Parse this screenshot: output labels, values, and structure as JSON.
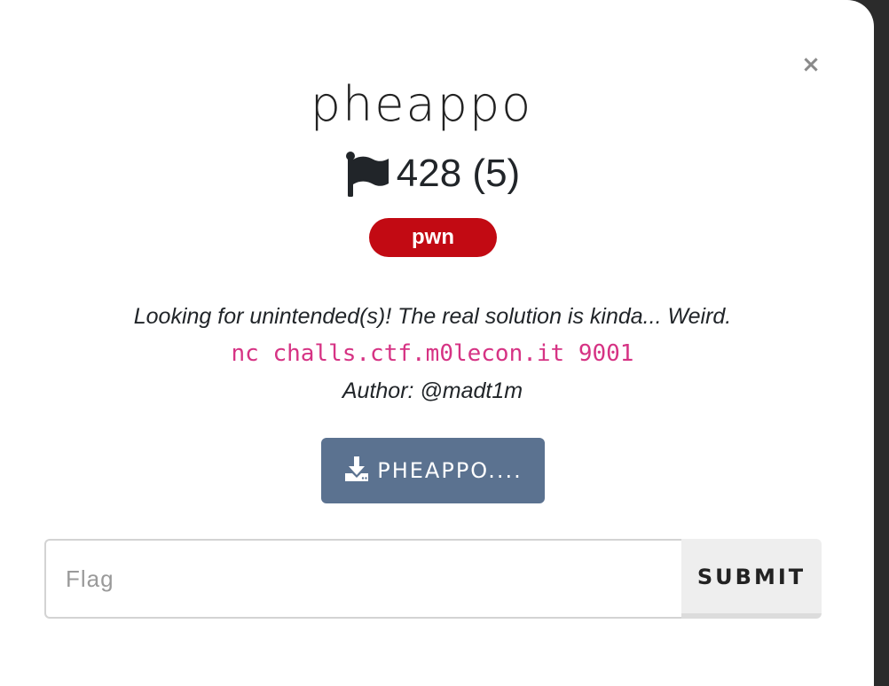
{
  "modal": {
    "close_label": "×",
    "title": "pheappo",
    "score": {
      "flag_icon": "flag-icon",
      "text": "428 (5)"
    },
    "category": {
      "label": "pwn",
      "color": "#c20a13"
    },
    "description": {
      "text": "Looking for unintended(s)! The real solution is kinda... Weird.",
      "command": "nc challs.ctf.m0lecon.it 9001",
      "author": "Author: @madt1m"
    },
    "download": {
      "icon": "download-icon",
      "label": "PHEAPPO...."
    },
    "flag_form": {
      "input_value": "",
      "input_placeholder": "Flag",
      "submit_label": "SUBMIT"
    }
  },
  "colors": {
    "accent_button": "#5b7290",
    "command_text": "#d63384"
  }
}
